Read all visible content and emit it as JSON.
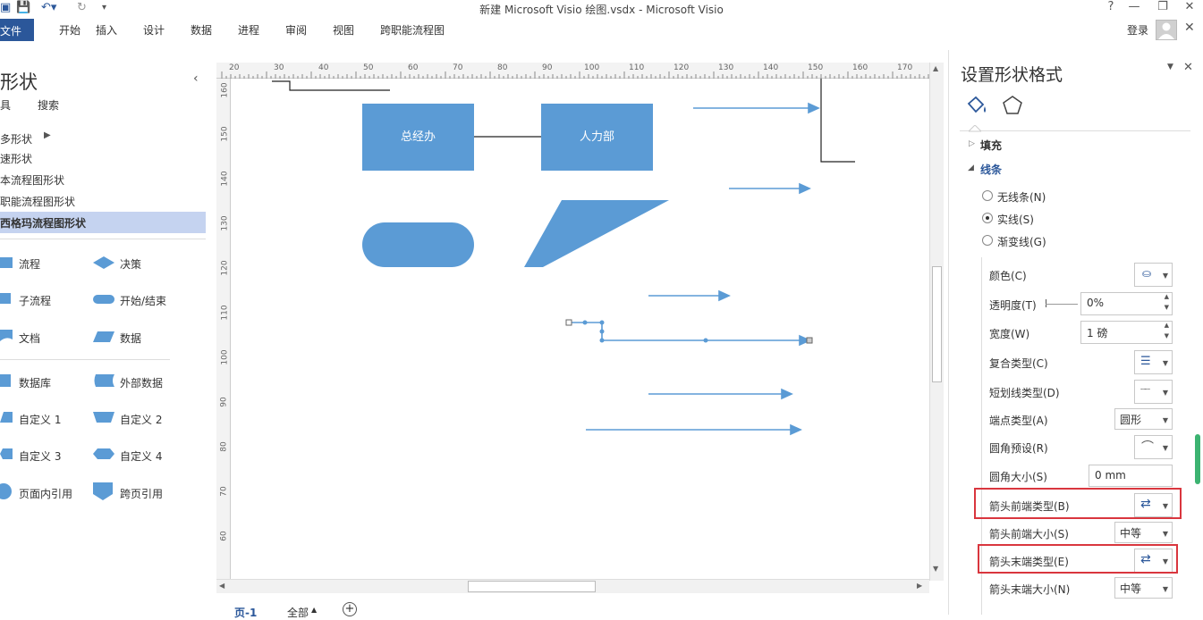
{
  "window": {
    "title": "新建 Microsoft Visio 绘图.vsdx - Microsoft Visio",
    "help": "?",
    "login": "登录"
  },
  "ribbon": {
    "tabs": [
      "文件",
      "开始",
      "插入",
      "设计",
      "数据",
      "进程",
      "审阅",
      "视图",
      "跨职能流程图"
    ]
  },
  "shapes_pane": {
    "title": "形状",
    "subtabs": [
      "具",
      "搜索"
    ],
    "categories": [
      "多形状",
      "速形状",
      "本流程图形状",
      "职能流程图形状",
      "西格玛流程图形状"
    ],
    "items": [
      "流程",
      "决策",
      "子流程",
      "开始/结束",
      "文档",
      "数据",
      "数据库",
      "外部数据",
      "自定义 1",
      "自定义 2",
      "自定义 3",
      "自定义 4",
      "页面内引用",
      "跨页引用"
    ]
  },
  "canvas": {
    "box1": "总经办",
    "box2": "人力部",
    "ruler_top": [
      "20",
      "30",
      "40",
      "50",
      "60",
      "70",
      "80",
      "90",
      "100",
      "110",
      "120",
      "130",
      "140",
      "150",
      "160",
      "170"
    ],
    "ruler_left": [
      "160",
      "150",
      "140",
      "130",
      "120",
      "110",
      "100",
      "90",
      "80",
      "70",
      "60"
    ]
  },
  "statusbar": {
    "page": "页-1",
    "all": "全部",
    "add": "+"
  },
  "format_pane": {
    "title": "设置形状格式",
    "sections": {
      "fill": "填充",
      "line": "线条"
    },
    "radios": [
      "无线条(N)",
      "实线(S)",
      "渐变线(G)"
    ],
    "rows": {
      "color": "颜色(C)",
      "transparency": "透明度(T)",
      "transparency_value": "0%",
      "width": "宽度(W)",
      "width_value": "1 磅",
      "compound": "复合类型(C)",
      "dash": "短划线类型(D)",
      "cap": "端点类型(A)",
      "cap_value": "圆形",
      "join": "圆角预设(R)",
      "round_size": "圆角大小(S)",
      "round_size_value": "0 mm",
      "begin_arrow": "箭头前端类型(B)",
      "begin_size": "箭头前端大小(S)",
      "begin_size_value": "中等",
      "end_arrow": "箭头末端类型(E)",
      "end_size": "箭头末端大小(N)",
      "end_size_value": "中等"
    }
  }
}
